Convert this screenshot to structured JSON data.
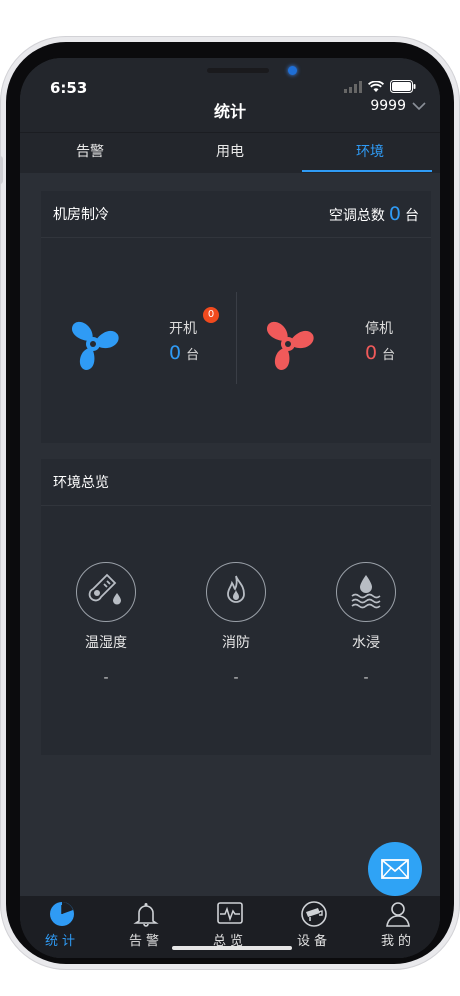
{
  "status": {
    "time": "6:53"
  },
  "nav": {
    "title": "统计",
    "site": "9999"
  },
  "tabs": [
    {
      "label": "告警"
    },
    {
      "label": "用电"
    },
    {
      "label": "环境"
    }
  ],
  "cooling": {
    "title": "机房制冷",
    "total_label": "空调总数",
    "total_value": "0",
    "total_unit": "台",
    "running": {
      "label": "开机",
      "badge": "0",
      "value": "0",
      "unit": "台"
    },
    "stopped": {
      "label": "停机",
      "value": "0",
      "unit": "台"
    }
  },
  "environment": {
    "title": "环境总览",
    "items": [
      {
        "label": "温湿度",
        "value": "-"
      },
      {
        "label": "消防",
        "value": "-"
      },
      {
        "label": "水浸",
        "value": "-"
      }
    ]
  },
  "bottom_nav": [
    {
      "label": "统计"
    },
    {
      "label": "告警"
    },
    {
      "label": "总览"
    },
    {
      "label": "设备"
    },
    {
      "label": "我的"
    }
  ],
  "colors": {
    "accent": "#2f9bf5",
    "danger": "#f05a5a",
    "badge": "#f04a1e"
  }
}
